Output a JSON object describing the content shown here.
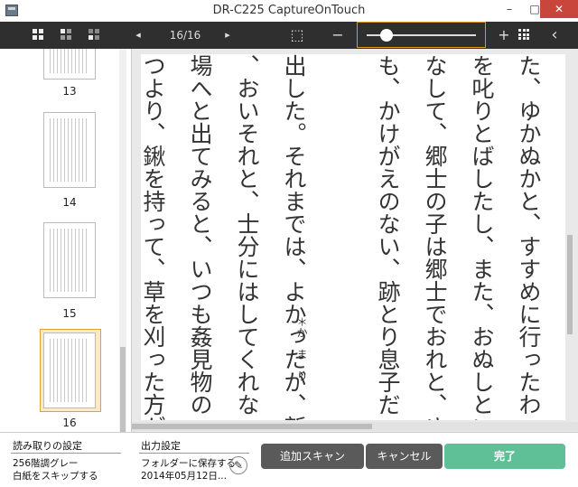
{
  "window": {
    "title": "DR-C225 CaptureOnTouch",
    "minimize": "–",
    "maximize": "□",
    "close": "✕"
  },
  "toolbar": {
    "prev": "◂",
    "page_indicator": "16/16",
    "next": "▸",
    "fit": "⬚",
    "zoom_out": "−",
    "zoom_in": "+",
    "collapse": "‹",
    "zoom_level": 0.18
  },
  "thumbnails": [
    {
      "label": "13"
    },
    {
      "label": "14"
    },
    {
      "label": "15"
    },
    {
      "label": "16"
    }
  ],
  "page_text": {
    "columns": [
      "た、ゆかぬかと、すすめに行ったわ",
      "を叱りとばしたし、また、おぬしとい",
      "なして、郷士の子は郷士でおれと、ゆ",
      "も、かけがえのない、跡とり息子だ",
      "",
      "出した。それまでは、よかったが、新",
      "、おいそれと、士分にはしてくれな",
      "場へと出てみると、いつも姦見物の",
      "つより、鍬を持って、草を刈った方が"
    ],
    "ruby": "＊か　ま　り"
  },
  "bottom": {
    "scan_settings_label": "読み取りの設定",
    "scan_settings_line1": "256階調グレー",
    "scan_settings_line2": "白紙をスキップする",
    "output_settings_label": "出力設定",
    "output_settings_line1": "フォルダーに保存する",
    "output_settings_line2": "2014年05月12日...",
    "edit_icon_glyph": "✎",
    "add_scan_button": "追加スキャン",
    "cancel_button": "キャンセル",
    "done_button": "完了"
  }
}
